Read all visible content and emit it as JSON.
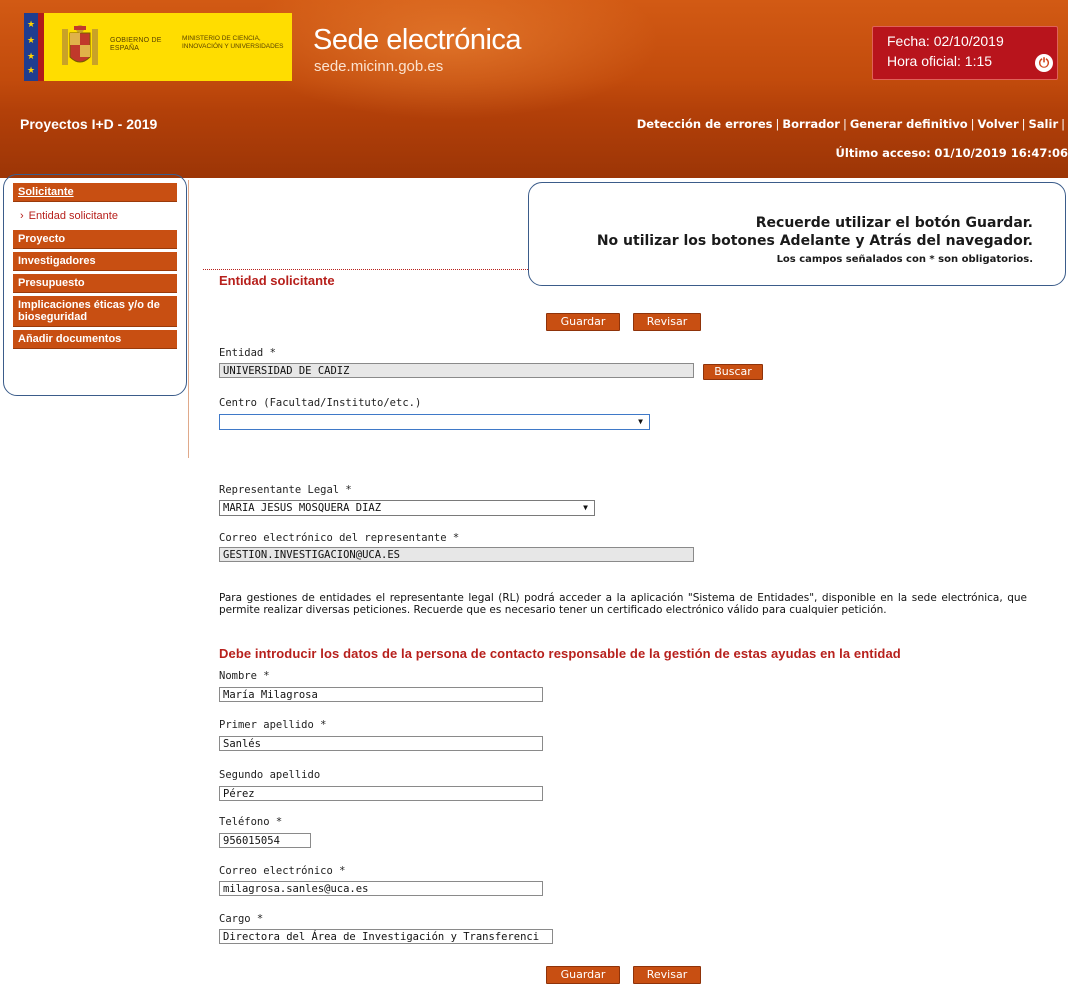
{
  "header": {
    "gobierno_label": "GOBIERNO DE ESPAÑA",
    "ministerio_label": "MINISTERIO DE CIENCIA, INNOVACIÓN Y UNIVERSIDADES",
    "site_title": "Sede electrónica",
    "site_url": "sede.micinn.gob.es",
    "fecha": "Fecha: 02/10/2019",
    "hora": "Hora oficial: 1:15",
    "project_title": "Proyectos I+D - 2019",
    "nav": [
      "Detección de errores",
      "Borrador",
      "Generar definitivo",
      "Volver",
      "Salir"
    ],
    "last_access_label": "Último acceso:",
    "last_access_value": "01/10/2019 16:47:06"
  },
  "sidebar": {
    "items": [
      {
        "label": "Solicitante"
      },
      {
        "label": "Entidad solicitante"
      },
      {
        "label": "Proyecto"
      },
      {
        "label": "Investigadores"
      },
      {
        "label": "Presupuesto"
      },
      {
        "label": "Implicaciones éticas y/o de bioseguridad"
      },
      {
        "label": "Añadir documentos"
      }
    ]
  },
  "notice": {
    "line1": "Recuerde utilizar el botón Guardar.",
    "line2": "No utilizar los botones Adelante y Atrás del navegador.",
    "line3": "Los campos señalados con * son obligatorios."
  },
  "form": {
    "section_title": "Entidad solicitante",
    "save_label": "Guardar",
    "review_label": "Revisar",
    "entidad_label": "Entidad *",
    "entidad_value": "UNIVERSIDAD DE CADIZ",
    "search_label": "Buscar",
    "centro_label": "Centro (Facultad/Instituto/etc.)",
    "centro_value": "",
    "representante_label": "Representante Legal *",
    "representante_value": "MARIA JESUS MOSQUERA DIAZ",
    "correo_rep_label": "Correo electrónico del representante *",
    "correo_rep_value": "GESTION.INVESTIGACION@UCA.ES",
    "info_paragraph": "Para gestiones de entidades el representante legal (RL) podrá acceder a la aplicación \"Sistema de Entidades\", disponible en la sede electrónica, que permite realizar diversas peticiones. Recuerde que es necesario tener un certificado electrónico válido para cualquier petición.",
    "contact_title": "Debe introducir los datos de la persona de contacto responsable de la gestión de estas ayudas en la entidad",
    "nombre_label": "Nombre  *",
    "nombre_value": "María Milagrosa",
    "apellido1_label": "Primer apellido  *",
    "apellido1_value": "Sanlés",
    "apellido2_label": "Segundo apellido",
    "apellido2_value": "Pérez",
    "telefono_label": "Teléfono  *",
    "telefono_value": "956015054",
    "correo_label": "Correo electrónico  *",
    "correo_value": "milagrosa.sanles@uca.es",
    "cargo_label": "Cargo  *",
    "cargo_value": "Directora del Área de Investigación y Transferenci"
  },
  "colors": {
    "header_orange": "#c24b0c",
    "accent_red": "#b7201c",
    "button_orange": "#c84f12",
    "outline_blue": "#3b5c8a"
  }
}
